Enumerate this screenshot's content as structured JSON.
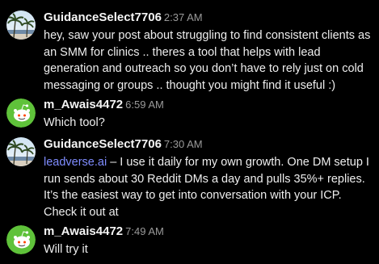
{
  "messages": [
    {
      "username": "GuidanceSelect7706",
      "time": "2:37 AM",
      "text": "hey, saw your post about struggling to find consistent clients as an SMM for clinics .. theres a tool that helps with lead generation and outreach so you don’t have to rely just on cold messaging or groups .. thought you might find it useful :)"
    },
    {
      "username": "m_Awais4472",
      "time": "6:59 AM",
      "text": "Which tool?"
    },
    {
      "username": "GuidanceSelect7706",
      "time": "7:30 AM",
      "link_text": "leadverse.ai",
      "text": " – I use it daily for my own growth. One DM setup I run sends about 30 Reddit DMs a day and pulls 35%+ replies. It’s the easiest way to get into conversation with your ICP. Check it out at"
    },
    {
      "username": "m_Awais4472",
      "time": "7:49 AM",
      "text": "Will try it"
    }
  ],
  "colors": {
    "background": "#000000",
    "link": "#7f8cff",
    "timestamp": "#9a9a9a",
    "snoo_avatar_bg": "#5fc23a"
  },
  "icons": {
    "guidance_avatar": "beach-palm-photo-avatar",
    "awais_avatar": "reddit-snoo-avatar"
  }
}
